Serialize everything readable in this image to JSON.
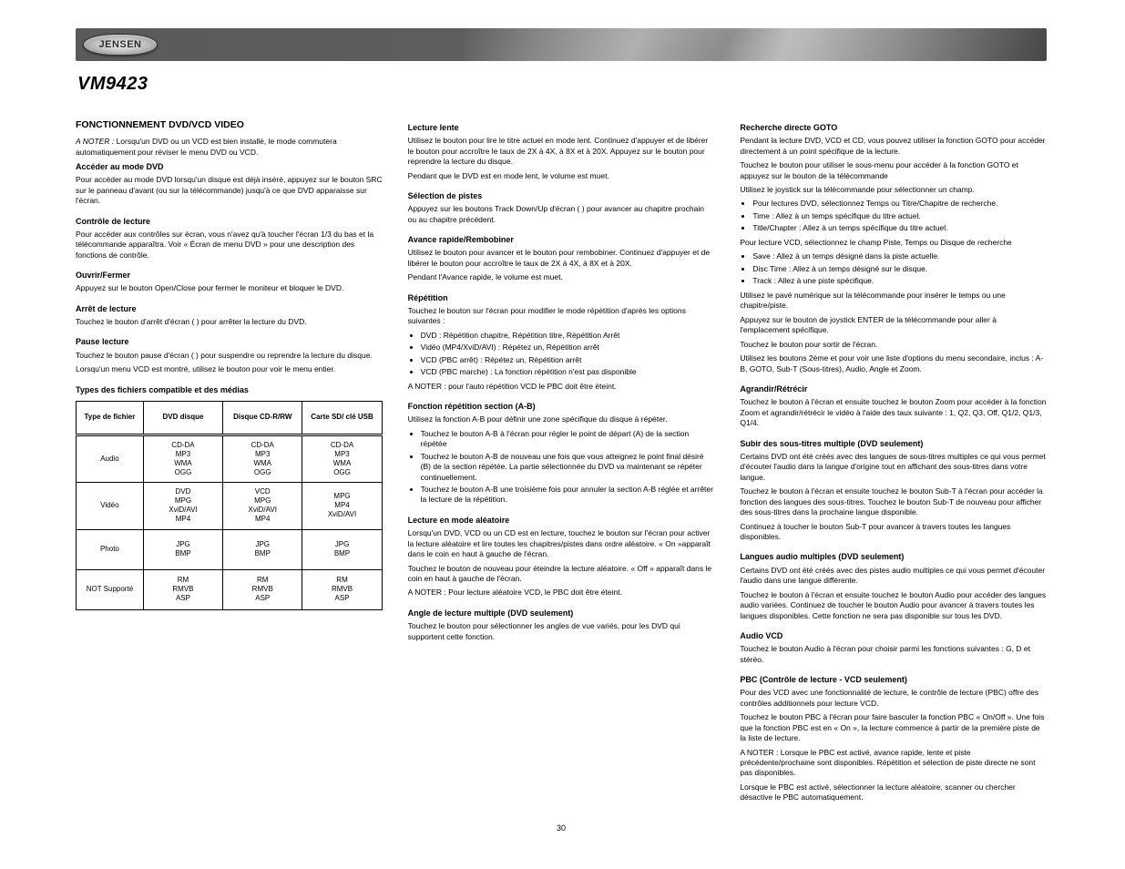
{
  "brand": "JENSEN",
  "model": "VM9423",
  "page_number": "30",
  "col1": {
    "h2": "FONCTIONNEMENT DVD/VCD VIDEO",
    "note": "Lorsqu'un DVD ou un VCD est bien installé, le mode commutera automatiquement pour réviser le menu DVD ou VCD.",
    "accessing": {
      "title": "Accéder au mode DVD",
      "p": "Pour accéder au mode DVD lorsqu'un disque est déjà inséré, appuyez sur le bouton SRC sur le panneau d'avant (ou sur la télécommande) jusqu'à ce que DVD apparaisse sur l'écran."
    },
    "control": {
      "title": "Contrôle de lecture",
      "p": "Pour accéder aux contrôles sur écran, vous n'avez qu'à toucher l'écran 1/3 du bas et la télécommande apparaîtra. Voir « Écran de menu DVD » pour une description des fonctions de contrôle."
    },
    "open": {
      "title": "Ouvrir/Fermer",
      "p": "Appuyez sur le bouton Open/Close pour fermer le moniteur et bloquer le DVD."
    },
    "stop": {
      "title": "Arrêt de lecture",
      "p": "Touchez le bouton d'arrêt d'écran (    ) pour arrêter la lecture du DVD."
    },
    "pause": {
      "title": "Pause lecture",
      "p1": "Touchez le bouton pause d'écran (    ) pour suspendre ou reprendre la lecture du disque.",
      "p2": "Lorsqu'un menu VCD est montré, utilisez le bouton    pour voir le menu entier."
    },
    "table": {
      "title": "Types des fichiers compatible et des médias",
      "headers": [
        "Type de fichier",
        "DVD disque",
        "Disque CD-R/RW",
        "Carte SD/ clé USB"
      ],
      "rows": [
        [
          "Audio",
          "CD-DA\nMP3\nWMA\nOGG",
          "CD-DA\nMP3\nWMA\nOGG",
          "CD-DA\nMP3\nWMA\nOGG"
        ],
        [
          "Vidéo",
          "DVD\nMPG\nXviD/AVI\nMP4",
          "VCD\nMPG\nXviD/AVI\nMP4",
          "MPG\nMP4\nXviD/AVI"
        ],
        [
          "Photo",
          "JPG\nBMP",
          "JPG\nBMP",
          "JPG\nBMP"
        ],
        [
          "NOT Supporté",
          "RM\nRMVB\nASP",
          "RM\nRMVB\nASP",
          "RM\nRMVB\nASP"
        ]
      ]
    }
  },
  "col2": {
    "slow": {
      "title": "Lecture lente",
      "p1": "Utilisez le bouton    pour lire le titre actuel en mode lent. Continuez d'appuyer et de libérer le bouton pour accroître le taux de 2X à 4X, à 8X et à 20X. Appuyez sur le bouton    pour reprendre la lecture du disque.",
      "p2": "Pendant que le DVD est en mode lent, le volume est muet."
    },
    "track": {
      "title": "Sélection de pistes",
      "p": "Appuyez sur les boutons Track Down/Up d'écran (    ) pour avancer au chapitre prochain ou au chapitre précédent."
    },
    "fast": {
      "title": "Avance rapide/Rembobiner",
      "p1": "Utilisez le bouton    pour avancer et le bouton    pour rembobiner. Continuez d'appuyer et de libérer le bouton pour accroître le taux de 2X à 4X, à 8X et à 20X.",
      "p2": "Pendant l'Avance rapide, le volume est muet."
    },
    "repeat": {
      "title": "Répétition",
      "p1": "Touchez le bouton    sur l'écran pour modifier le mode répétition d'après les options suivantes :",
      "bullets": [
        "DVD : Répétition chapitre, Répétition titre, Répétition Arrêt",
        "Vidéo (MP4/XviD/AVI) : Répétez un, Répétition arrêt",
        "VCD (PBC arrêt) : Répétez un, Répétition arrêt",
        "VCD (PBC marche) : La fonction répétition n'est pas disponible"
      ],
      "note": "A NOTER : pour l'auto répétition VCD le PBC doit être éteint."
    },
    "section": {
      "title": "Fonction répétition section (A-B)",
      "p": "Utilisez la fonction A-B pour définir une zone spécifique du disque à répéter.",
      "bullets": [
        "Touchez le bouton A-B à l'écran pour régler le point de départ (A) de la section répétée",
        "Touchez le bouton A-B de nouveau une fois que vous atteignez le point final désiré (B) de la section répétée. La partie sélectionnée du DVD va maintenant se répéter continuellement.",
        "Touchez le bouton A-B une troisième fois pour annuler la section A-B réglée et arrêter la lecture de la répétition."
      ]
    },
    "random": {
      "title": "Lecture en mode aléatoire",
      "p": "Lorsqu'un DVD, VCD ou un CD est en lecture, touchez le bouton    sur l'écran pour activer la lecture aléatoire et lire toutes les chapitres/pistes dans ordre aléatoire. « On »apparaît dans le coin en haut à gauche de l'écran.",
      "p2": "Touchez le bouton    de nouveau pour éteindre la lecture aléatoire. « Off » apparaît dans le coin en haut à gauche de l'écran.",
      "note": "A NOTER : Pour lecture aléatoire VCD, le PBC doit être éteint."
    },
    "angle": {
      "title": "Angle de lecture multiple (DVD seulement)",
      "p": "Touchez le bouton    pour sélectionner les angles de vue variés, pour les DVD qui supportent cette fonction."
    }
  },
  "col3": {
    "goto": {
      "title": "Recherche directe GOTO",
      "p": "Pendant la lecture DVD, VCD et CD, vous pouvez utiliser la fonction GOTO pour accéder directement à un point spécifique de la lecture.",
      "p2": "Touchez le bouton                pour utiliser le sous-menu pour accéder à la fonction GOTO et appuyez sur le bouton de la télécommande",
      "p3": "Utilisez le joystick sur la télécommande pour sélectionner un champ.",
      "bullets": [
        "Pour lectures DVD, sélectionnez Temps ou Titre/Chapitre de recherche.",
        "Time : Allez à un temps spécifique du titre actuel.",
        "Title/Chapter : Allez à un temps spécifique du titre actuel."
      ],
      "p4": "Pour lecture VCD, sélectionnez le champ Piste, Temps ou Disque de recherche",
      "bullets2": [
        "Save : Allez à un temps désigné dans la piste actuelle.",
        "Disc Time : Allez à un temps désigné sur le disque.",
        "Track : Allez à une piste spécifique."
      ],
      "p5a": "Utilisez le pavé numérique sur la télécommande pour insérer le temps ou une chapitre/piste.",
      "p5b": "Appuyez sur le bouton de joystick ENTER de la télécommande pour aller à l'emplacement spécifique.",
      "p5c": "Touchez le bouton    pour sortir de l'écran.",
      "p6": "Utilisez les boutons 2ème et    pour voir une liste d'options du menu secondaire, inclus : A-B, GOTO, Sub-T (Sous-titres), Audio, Angle et Zoom."
    },
    "zoom": {
      "title": "Agrandir/Rétrécir",
      "p": "Touchez le bouton                à l'écran et ensuite touchez le bouton Zoom pour accéder à la fonction Zoom et agrandir/rétrécir le vidéo à l'aide des taux suivante : 1, Q2, Q3, Off, Q1/2, Q1/3, Q1/4."
    },
    "subtitle": {
      "title": "Subir des sous-titres multiple (DVD seulement)",
      "p": "Certains DVD ont été créés avec des langues de sous-titres multiples ce qui vous permet d'écouter l'audio dans la langue d'origine tout en affichant des sous-titres dans votre langue.",
      "p2": "Touchez le bouton                à l'écran et ensuite touchez le bouton Sub-T à l'écran pour accéder la fonction des langues des sous-titres. Touchez le bouton Sub-T de nouveau pour afficher des sous-titres dans la prochaine langue disponible.",
      "p3": "Continuez à toucher le bouton Sub-T pour avancer à travers toutes les langues disponibles."
    },
    "audiolang": {
      "title": "Langues audio multiples (DVD seulement)",
      "p": "Certains DVD ont été créés avec des pistes audio multiples ce qui vous permet d'écouter l'audio dans une langue différente.",
      "p2": "Touchez le bouton                à l'écran et ensuite touchez le bouton Audio pour accéder des langues audio variées. Continuez de toucher le bouton Audio pour avancer à travers toutes les langues disponibles. Cette fonction ne sera pas disponible sur tous les DVD."
    },
    "audiovcd": {
      "title": "Audio VCD",
      "p": "Touchez le bouton Audio à l'écran pour choisir parmi les fonctions suivantes : G, D et stéréo."
    },
    "pbc": {
      "title": "PBC (Contrôle de lecture - VCD seulement)",
      "p": "Pour des VCD avec une fonctionnalité de lecture, le contrôle de lecture (PBC) offre des contrôles additionnels pour lecture VCD.",
      "p2": "Touchez le bouton PBC à l'écran pour faire basculer la fonction PBC « On/Off ». Une fois que la fonction PBC est en « On », la lecture commence à partir de la première piste de la liste de lecture.",
      "note": "A NOTER : Lorsque le PBC est activé, avance rapide, lente et piste précédente/prochaine sont disponibles. Répétition et sélection de piste directe ne sont pas disponibles.",
      "p3": "Lorsque le PBC est activé, sélectionner la lecture aléatoire, scanner ou chercher désactive le PBC automatiquement."
    }
  }
}
